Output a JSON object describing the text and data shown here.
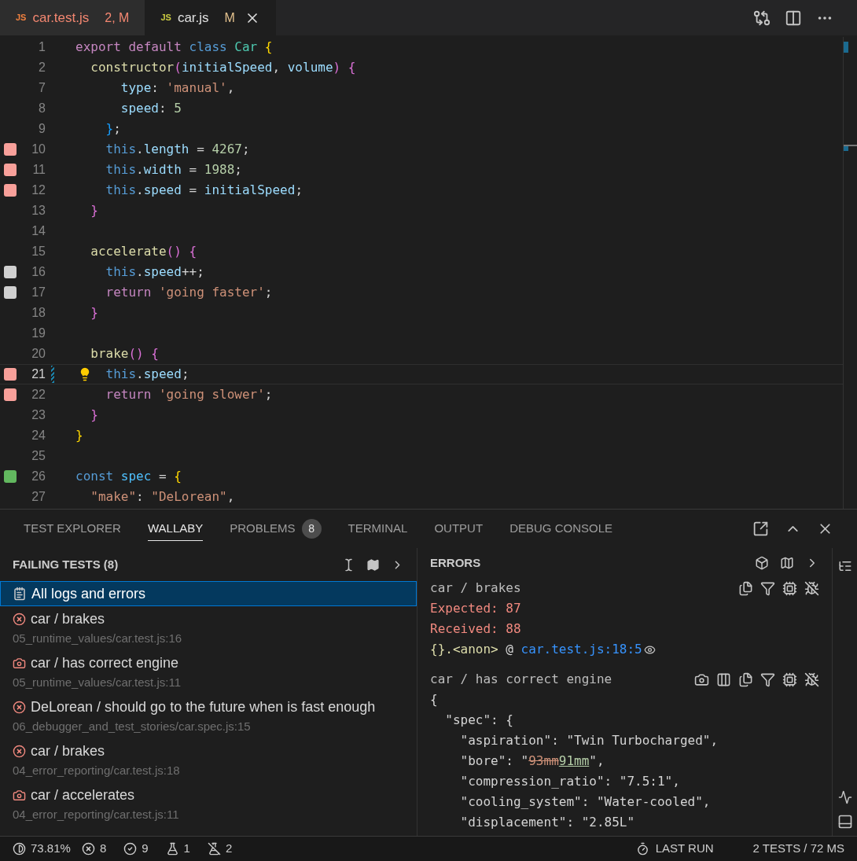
{
  "editor_tabs": [
    {
      "icon_text": "JS",
      "label": "car.test.js",
      "status": "2, M",
      "kind": "errors",
      "selected": false
    },
    {
      "icon_text": "JS",
      "label": "car.js",
      "status": "M",
      "kind": "modified",
      "selected": true
    }
  ],
  "code_lines": [
    {
      "number": "1",
      "kind": "plain",
      "current": false,
      "tokens": [
        {
          "kind": "keyword",
          "text": "export default "
        },
        {
          "kind": "storage",
          "text": "class "
        },
        {
          "kind": "class",
          "text": "Car "
        },
        {
          "kind": "brace1",
          "text": "{"
        }
      ]
    },
    {
      "number": "2",
      "kind": "plain",
      "current": false,
      "tokens": [
        {
          "kind": "function",
          "text": "  constructor"
        },
        {
          "kind": "brace2",
          "text": "("
        },
        {
          "kind": "variable",
          "text": "initialSpeed"
        },
        {
          "kind": "plain",
          "text": ", "
        },
        {
          "kind": "variable",
          "text": "volume"
        },
        {
          "kind": "brace2",
          "text": ") {"
        }
      ]
    },
    {
      "number": "7",
      "kind": "plain",
      "current": false,
      "tokens": [
        {
          "kind": "variable",
          "text": "      type"
        },
        {
          "kind": "plain",
          "text": ": "
        },
        {
          "kind": "string",
          "text": "'manual'"
        },
        {
          "kind": "plain",
          "text": ","
        }
      ]
    },
    {
      "number": "8",
      "kind": "plain",
      "current": false,
      "tokens": [
        {
          "kind": "variable",
          "text": "      speed"
        },
        {
          "kind": "plain",
          "text": ": "
        },
        {
          "kind": "number",
          "text": "5"
        }
      ]
    },
    {
      "number": "9",
      "kind": "plain",
      "current": false,
      "tokens": [
        {
          "kind": "brace3",
          "text": "    }"
        },
        {
          "kind": "plain",
          "text": ";"
        }
      ]
    },
    {
      "number": "10",
      "kind": "failing",
      "current": false,
      "tokens": [
        {
          "kind": "storage",
          "text": "    this"
        },
        {
          "kind": "plain",
          "text": "."
        },
        {
          "kind": "variable",
          "text": "length"
        },
        {
          "kind": "plain",
          "text": " = "
        },
        {
          "kind": "number",
          "text": "4267"
        },
        {
          "kind": "plain",
          "text": ";"
        }
      ]
    },
    {
      "number": "11",
      "kind": "failing",
      "current": false,
      "tokens": [
        {
          "kind": "storage",
          "text": "    this"
        },
        {
          "kind": "plain",
          "text": "."
        },
        {
          "kind": "variable",
          "text": "width"
        },
        {
          "kind": "plain",
          "text": " = "
        },
        {
          "kind": "number",
          "text": "1988"
        },
        {
          "kind": "plain",
          "text": ";"
        }
      ]
    },
    {
      "number": "12",
      "kind": "failing",
      "current": false,
      "tokens": [
        {
          "kind": "storage",
          "text": "    this"
        },
        {
          "kind": "plain",
          "text": "."
        },
        {
          "kind": "variable",
          "text": "speed"
        },
        {
          "kind": "plain",
          "text": " = "
        },
        {
          "kind": "variable",
          "text": "initialSpeed"
        },
        {
          "kind": "plain",
          "text": ";"
        }
      ]
    },
    {
      "number": "13",
      "kind": "plain",
      "current": false,
      "tokens": [
        {
          "kind": "brace2",
          "text": "  }"
        }
      ]
    },
    {
      "number": "14",
      "kind": "plain",
      "current": false
    },
    {
      "number": "15",
      "kind": "plain",
      "current": false,
      "tokens": [
        {
          "kind": "function",
          "text": "  accelerate"
        },
        {
          "kind": "brace2",
          "text": "() {"
        }
      ]
    },
    {
      "number": "16",
      "kind": "uncovered",
      "current": false,
      "tokens": [
        {
          "kind": "storage",
          "text": "    this"
        },
        {
          "kind": "plain",
          "text": "."
        },
        {
          "kind": "variable",
          "text": "speed"
        },
        {
          "kind": "plain",
          "text": "++;"
        }
      ]
    },
    {
      "number": "17",
      "kind": "uncovered",
      "current": false,
      "tokens": [
        {
          "kind": "keyword",
          "text": "    return "
        },
        {
          "kind": "string",
          "text": "'going faster'"
        },
        {
          "kind": "plain",
          "text": ";"
        }
      ]
    },
    {
      "number": "18",
      "kind": "plain",
      "current": false,
      "tokens": [
        {
          "kind": "brace2",
          "text": "  }"
        }
      ]
    },
    {
      "number": "19",
      "kind": "plain",
      "current": false
    },
    {
      "number": "20",
      "kind": "plain",
      "current": false,
      "tokens": [
        {
          "kind": "function",
          "text": "  brake"
        },
        {
          "kind": "brace2",
          "text": "() {"
        }
      ]
    },
    {
      "number": "21",
      "kind": "failing",
      "current": true,
      "tokens": [
        {
          "kind": "storage",
          "text": "    this"
        },
        {
          "kind": "plain",
          "text": "."
        },
        {
          "kind": "variable",
          "text": "speed"
        },
        {
          "kind": "plain",
          "text": ";"
        }
      ]
    },
    {
      "number": "22",
      "kind": "failing",
      "current": false,
      "tokens": [
        {
          "kind": "keyword",
          "text": "    return "
        },
        {
          "kind": "string",
          "text": "'going slower'"
        },
        {
          "kind": "plain",
          "text": ";"
        }
      ]
    },
    {
      "number": "23",
      "kind": "plain",
      "current": false,
      "tokens": [
        {
          "kind": "brace2",
          "text": "  }"
        }
      ]
    },
    {
      "number": "24",
      "kind": "plain",
      "current": false,
      "tokens": [
        {
          "kind": "brace1",
          "text": "}"
        }
      ]
    },
    {
      "number": "25",
      "kind": "plain",
      "current": false
    },
    {
      "number": "26",
      "kind": "covered",
      "current": false,
      "tokens": [
        {
          "kind": "storage",
          "text": "const "
        },
        {
          "kind": "constant",
          "text": "spec"
        },
        {
          "kind": "plain",
          "text": " = "
        },
        {
          "kind": "brace1",
          "text": "{"
        }
      ]
    },
    {
      "number": "27",
      "kind": "plain",
      "current": false,
      "tokens": [
        {
          "kind": "string",
          "text": "  \"make\""
        },
        {
          "kind": "plain",
          "text": ": "
        },
        {
          "kind": "string",
          "text": "\"DeLorean\""
        },
        {
          "kind": "plain",
          "text": ","
        }
      ]
    }
  ],
  "panel_tabs": [
    {
      "label": "TEST EXPLORER",
      "selected": false
    },
    {
      "label": "WALLABY",
      "selected": true
    },
    {
      "label": "PROBLEMS",
      "badge": "8",
      "selected": false
    },
    {
      "label": "TERMINAL",
      "selected": false
    },
    {
      "label": "OUTPUT",
      "selected": false
    },
    {
      "label": "DEBUG CONSOLE",
      "selected": false
    }
  ],
  "failing_tests": {
    "title": "FAILING TESTS (8)",
    "items": [
      {
        "kind": "logs",
        "name": "All logs and errors",
        "selected": true
      },
      {
        "kind": "error",
        "name": "car / brakes",
        "path": "05_runtime_values/car.test.js:16",
        "selected": false
      },
      {
        "kind": "snapshot",
        "name": "car / has correct engine",
        "path": "05_runtime_values/car.test.js:11",
        "selected": false
      },
      {
        "kind": "error",
        "name": "DeLorean / should go to the future when is fast enough",
        "path": "06_debugger_and_test_stories/car.spec.js:15",
        "selected": false
      },
      {
        "kind": "error",
        "name": "car / brakes",
        "path": "04_error_reporting/car.test.js:18",
        "selected": false
      },
      {
        "kind": "snapshot",
        "name": "car / accelerates",
        "path": "04_error_reporting/car.test.js:11",
        "selected": false
      }
    ]
  },
  "errors": {
    "title": "ERRORS",
    "blocks": [
      {
        "kind": "error",
        "title": "car / brakes",
        "lines": [
          [
            {
              "kind": "fail",
              "text": "Expected: 87"
            }
          ],
          [
            {
              "kind": "fail",
              "text": "Received: 88"
            }
          ],
          [
            {
              "kind": "function",
              "text": "{}.<anon>"
            },
            {
              "kind": "plain",
              "text": " @ "
            },
            {
              "kind": "link",
              "text": "car.test.js:18:5"
            }
          ]
        ]
      },
      {
        "kind": "snapshot",
        "title": "car / has correct engine",
        "lines": [
          [
            {
              "kind": "plain",
              "text": "{"
            }
          ],
          [
            {
              "kind": "plain",
              "text": "  \"spec\": {"
            }
          ],
          [
            {
              "kind": "plain",
              "text": "    \"aspiration\": \"Twin Turbocharged\","
            }
          ],
          [
            {
              "kind": "plain",
              "text": "    \"bore\": \""
            },
            {
              "kind": "removed",
              "text": "93mm"
            },
            {
              "kind": "added",
              "text": "91mm"
            },
            {
              "kind": "plain",
              "text": "\","
            }
          ],
          [
            {
              "kind": "plain",
              "text": "    \"compression_ratio\": \"7.5:1\","
            }
          ],
          [
            {
              "kind": "plain",
              "text": "    \"cooling_system\": \"Water-cooled\","
            }
          ],
          [
            {
              "kind": "plain",
              "text": "    \"displacement\": \"2.85L\""
            }
          ]
        ]
      }
    ]
  },
  "status_bar": {
    "coverage": "73.81%",
    "failing": "8",
    "passing": "9",
    "tests": "1",
    "other": "2",
    "last_run": "LAST RUN",
    "summary": "2 TESTS / 72 MS"
  }
}
